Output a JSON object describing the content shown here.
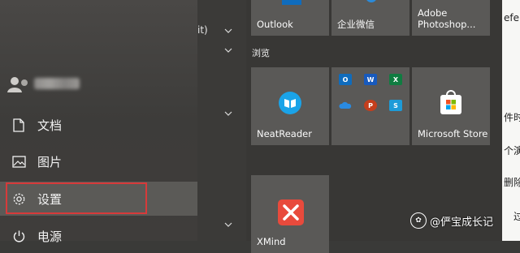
{
  "rail": {
    "items": [
      {
        "label": "文档",
        "icon": "document-icon"
      },
      {
        "label": "图片",
        "icon": "image-icon"
      },
      {
        "label": "设置",
        "icon": "gear-icon"
      },
      {
        "label": "电源",
        "icon": "power-icon"
      }
    ]
  },
  "list": {
    "fragment": "it)"
  },
  "tiles": {
    "top": [
      {
        "label": "Outlook"
      },
      {
        "label": "企业微信"
      },
      {
        "label": "Adobe\nPhotoshop..."
      }
    ],
    "group_title": "浏览",
    "neatreader": {
      "label": "NeatReader"
    },
    "store": {
      "label": "Microsoft Store"
    },
    "office_icons": [
      "O",
      "W",
      "X",
      "",
      "P",
      "S"
    ],
    "bottom": {
      "label": "XMind"
    }
  },
  "doc": {
    "fragments": [
      "efen",
      "件时",
      "个演",
      "删除",
      "过"
    ]
  },
  "watermark": {
    "text": "@俨宝成长记"
  },
  "colors": {
    "highlight_border": "#d73a3a",
    "tile_bg": "#5a5957",
    "outlook_blue": "#0f6cbd",
    "word_blue": "#185abd",
    "excel_green": "#107c41",
    "ppt_orange": "#c43e1c",
    "xmind_red": "#e84a3c"
  }
}
